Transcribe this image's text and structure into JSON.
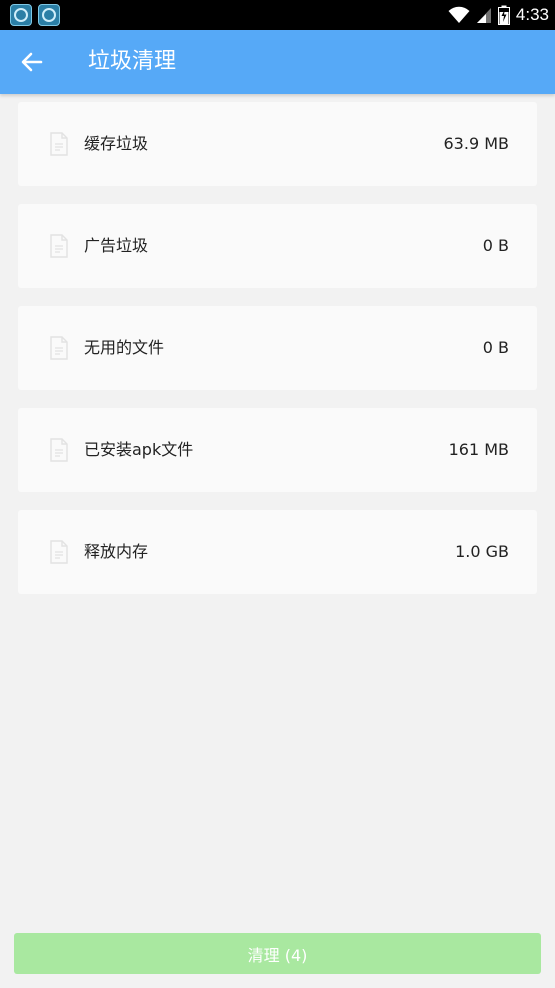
{
  "status_bar": {
    "time": "4:33",
    "notification_icons": [
      "app-notification-icon",
      "app-notification-icon"
    ]
  },
  "app_bar": {
    "title": "垃圾清理",
    "back_icon": "arrow-left-icon"
  },
  "items": [
    {
      "label": "缓存垃圾",
      "size": "63.9 MB"
    },
    {
      "label": "广告垃圾",
      "size": "0 B"
    },
    {
      "label": "无用的文件",
      "size": "0 B"
    },
    {
      "label": "已安装apk文件",
      "size": "161 MB"
    },
    {
      "label": "释放内存",
      "size": "1.0 GB"
    }
  ],
  "clean_button": {
    "label": "清理 (4)"
  },
  "colors": {
    "app_bar": "#56a9f7",
    "background": "#f2f2f2",
    "card": "#fafafa",
    "button": "#a9e8a0"
  }
}
